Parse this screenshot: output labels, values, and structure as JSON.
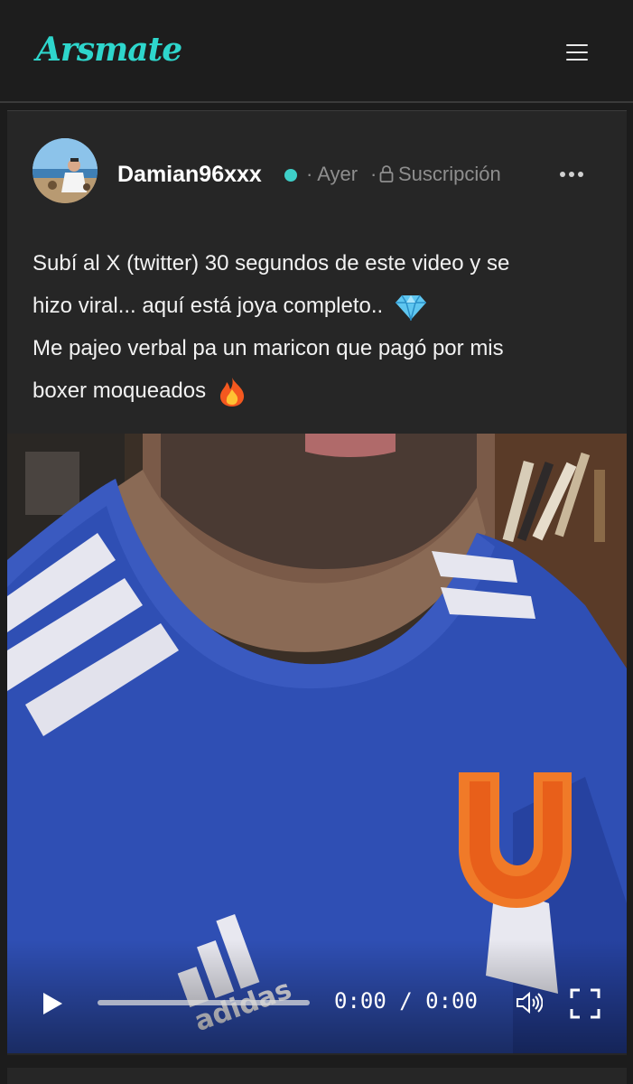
{
  "header": {
    "logo_text": "Arsmate",
    "menu_icon": "hamburger-menu-icon",
    "accent_color": "#2ed6cc"
  },
  "post": {
    "username": "Damian96xxx",
    "status_color": "#3ecfc8",
    "time": "· Ayer",
    "visibility_separator": "·",
    "visibility_label": "Suscripción",
    "visibility_icon": "lock-icon",
    "more_icon": "more-options-icon",
    "text_lines": [
      "Subí al X (twitter) 30 segundos de este video y se",
      "hizo viral... aquí está joya completo..",
      "Me pajeo verbal pa un maricon que pagó por mis",
      "boxer moqueados"
    ],
    "emojis": [
      "gem-emoji",
      "fire-emoji"
    ],
    "video": {
      "current_time": "0:00",
      "separator": "/",
      "duration": "0:00",
      "progress": 0,
      "play_icon": "play-icon",
      "volume_icon": "volume-icon",
      "fullscreen_icon": "fullscreen-icon",
      "shirt_logo_text": "adidas"
    }
  }
}
